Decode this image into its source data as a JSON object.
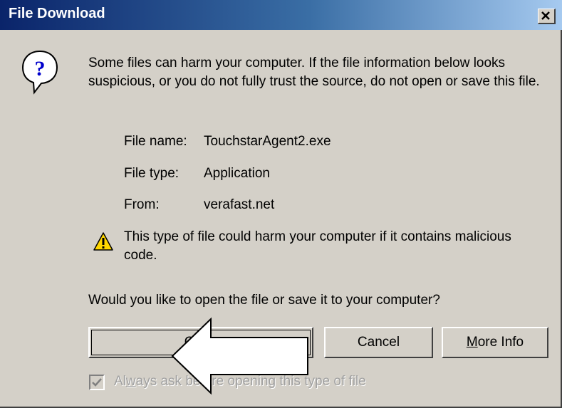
{
  "window": {
    "title": "File Download"
  },
  "intro_text": "Some files can harm your computer. If the file information below looks suspicious, or you do not fully trust the source, do not open or save this file.",
  "file_info": {
    "name_label": "File name:",
    "name_value": "TouchstarAgent2.exe",
    "type_label": "File type:",
    "type_value": "Application",
    "from_label": "From:",
    "from_value": "verafast.net"
  },
  "warning_text": "This type of file could harm your computer if it contains malicious code.",
  "question_text": "Would you like to open the file or save it to your computer?",
  "buttons": {
    "open_first": "O",
    "open_rest": "pen",
    "cancel": "Cancel",
    "more_first": "M",
    "more_rest": "ore Info"
  },
  "checkbox": {
    "label_pre": "Al",
    "label_mnemonic": "w",
    "label_post": "ays ask before opening this type of file",
    "checked": true,
    "disabled": true
  },
  "icons": {
    "question": "question-icon",
    "warning": "warning-icon",
    "close": "close-icon",
    "arrow": "pointer-arrow"
  },
  "colors": {
    "titlebar_start": "#0a246a",
    "titlebar_end": "#a6caf0",
    "dialog_bg": "#d4d0c8"
  }
}
